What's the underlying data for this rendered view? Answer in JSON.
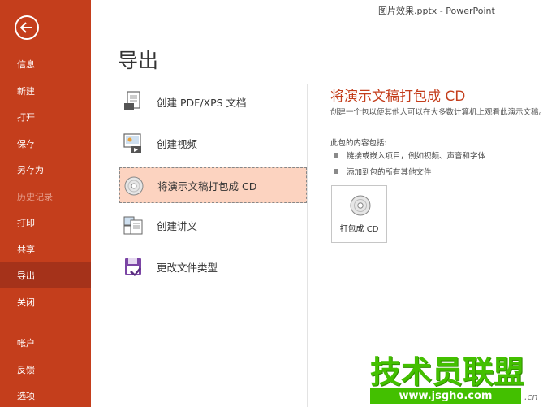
{
  "window": {
    "title": "图片效果.pptx  -  PowerPoint"
  },
  "sidebar": {
    "back_icon": "arrow-left-icon",
    "items": [
      {
        "label": "信息",
        "state": "normal"
      },
      {
        "label": "新建",
        "state": "normal"
      },
      {
        "label": "打开",
        "state": "normal"
      },
      {
        "label": "保存",
        "state": "normal"
      },
      {
        "label": "另存为",
        "state": "normal"
      },
      {
        "label": "历史记录",
        "state": "disabled"
      },
      {
        "label": "打印",
        "state": "normal"
      },
      {
        "label": "共享",
        "state": "normal"
      },
      {
        "label": "导出",
        "state": "active"
      },
      {
        "label": "关闭",
        "state": "normal"
      },
      {
        "label": "帐户",
        "state": "normal"
      },
      {
        "label": "反馈",
        "state": "normal"
      },
      {
        "label": "选项",
        "state": "normal"
      }
    ]
  },
  "main": {
    "title": "导出",
    "options": [
      {
        "label": "创建 PDF/XPS 文档",
        "icon": "pdf-document-icon"
      },
      {
        "label": "创建视频",
        "icon": "video-icon"
      },
      {
        "label": "将演示文稿打包成 CD",
        "icon": "cd-icon",
        "selected": true
      },
      {
        "label": "创建讲义",
        "icon": "handout-icon"
      },
      {
        "label": "更改文件类型",
        "icon": "save-disk-icon"
      }
    ]
  },
  "detail": {
    "title": "将演示文稿打包成 CD",
    "description": "创建一个包以便其他人可以在大多数计算机上观看此演示文稿。",
    "contains_heading": "此包的内容包括:",
    "bullets": [
      "链接或嵌入项目，例如视频、声音和字体",
      "添加到包的所有其他文件"
    ],
    "package_button_label": "打包成 CD"
  },
  "watermark": {
    "brand": "技术员联盟",
    "url": "www.jsgho.com",
    "suffix": ".cn"
  },
  "colors": {
    "accent": "#c43e1c",
    "accent_dark": "#a5321a",
    "selected_bg": "#fcd3c0",
    "watermark": "#43c000"
  }
}
